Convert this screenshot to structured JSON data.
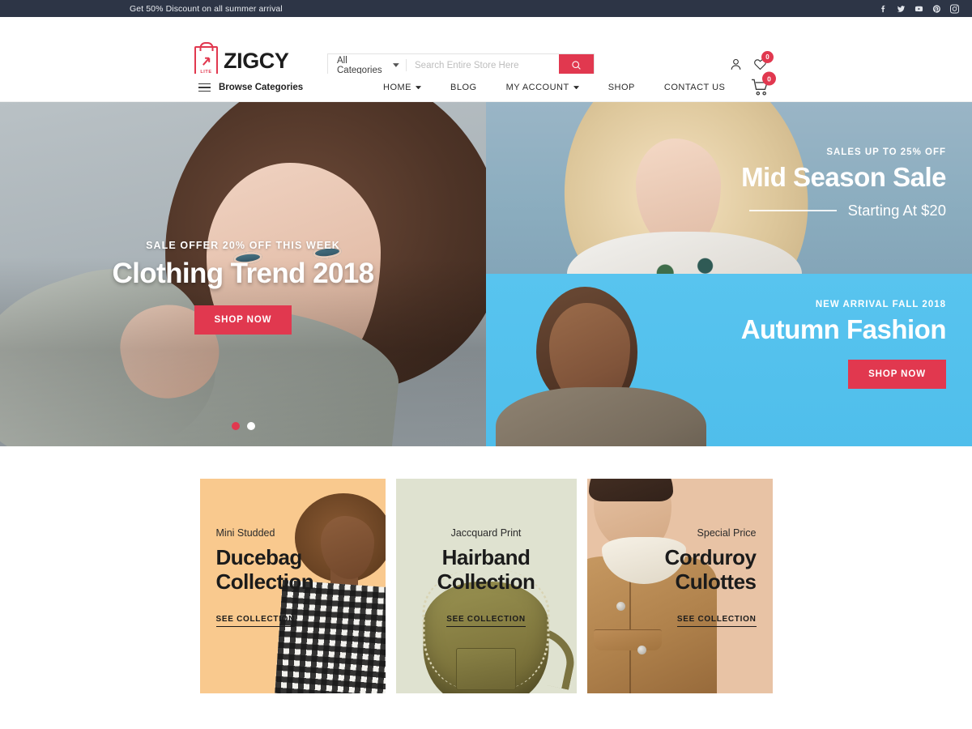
{
  "topbar": {
    "message": "Get 50% Discount on all summer arrival",
    "social": [
      {
        "name": "facebook-icon",
        "label": "Facebook"
      },
      {
        "name": "twitter-icon",
        "label": "Twitter"
      },
      {
        "name": "youtube-icon",
        "label": "YouTube"
      },
      {
        "name": "pinterest-icon",
        "label": "Pinterest"
      },
      {
        "name": "instagram-icon",
        "label": "Instagram"
      }
    ]
  },
  "header": {
    "logo_text": "ZIGCY",
    "logo_sub": "LITE",
    "search": {
      "category_label": "All Categories",
      "placeholder": "Search Entire Store Here",
      "value": ""
    },
    "account_icon": "user-icon",
    "wishlist_icon": "heart-icon",
    "wishlist_count": "0"
  },
  "nav": {
    "browse_label": "Browse Categories",
    "items": [
      {
        "label": "HOME",
        "has_dropdown": true
      },
      {
        "label": "BLOG",
        "has_dropdown": false
      },
      {
        "label": "MY ACCOUNT",
        "has_dropdown": true
      },
      {
        "label": "SHOP",
        "has_dropdown": false
      },
      {
        "label": "CONTACT US",
        "has_dropdown": false
      }
    ],
    "cart_icon": "shopping-cart-icon",
    "cart_count": "0"
  },
  "hero": {
    "main": {
      "eyebrow": "SALE OFFER 20% OFF THIS WEEK",
      "title": "Clothing Trend 2018",
      "cta": "SHOP NOW"
    },
    "carousel": {
      "slides": 2,
      "active_index": 0
    },
    "top_right": {
      "eyebrow": "SALES UP TO 25% OFF",
      "title": "Mid Season Sale",
      "subtitle": "Starting At $20"
    },
    "bottom_right": {
      "eyebrow": "NEW ARRIVAL FALL 2018",
      "title": "Autumn Fashion",
      "cta": "SHOP NOW"
    }
  },
  "collections": [
    {
      "eyebrow": "Mini Studded",
      "title": "Ducebag Collection",
      "link": "SEE COLLECTION",
      "bg_color": "#f9c98e"
    },
    {
      "eyebrow": "Jaccquard Print",
      "title": "Hairband Collection",
      "link": "SEE COLLECTION",
      "bg_color": "#dfe2d0"
    },
    {
      "eyebrow": "Special Price",
      "title": "Corduroy Culottes",
      "link": "SEE COLLECTION",
      "bg_color": "#e8c3a5"
    }
  ],
  "colors": {
    "accent_red": "#e1384f",
    "topbar_dark": "#2d3546",
    "hero_blue_light": "#8badbf",
    "hero_blue_bright": "#58c4ef"
  }
}
